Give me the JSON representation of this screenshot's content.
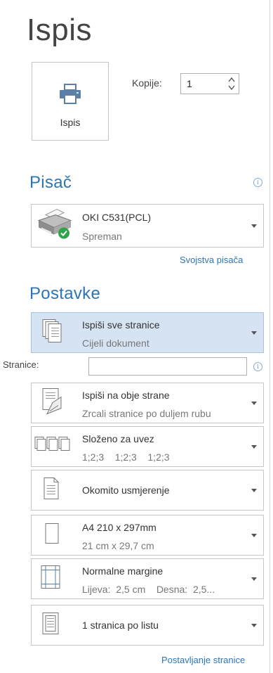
{
  "title": "Ispis",
  "print_button": {
    "label": "Ispis",
    "icon": "printer-icon"
  },
  "copies": {
    "label": "Kopije:",
    "value": "1"
  },
  "printer_section": {
    "title": "Pisač",
    "printer": {
      "name": "OKI C531(PCL)",
      "status": "Spreman",
      "icon": "printer-ready-icon"
    },
    "properties_link": "Svojstva pisača"
  },
  "settings_section": {
    "title": "Postavke",
    "items": [
      {
        "line1": "Ispiši sve stranice",
        "line2": "Cijeli dokument",
        "icon": "pages-icon",
        "selected": true
      },
      {
        "line1": "Ispiši na obje strane",
        "line2": "Zrcali stranice po duljem rubu",
        "icon": "duplex-icon"
      },
      {
        "line1": "Složeno za uvez",
        "line2": "1;2;3    1;2;3    1;2;3",
        "icon": "collated-icon"
      },
      {
        "line1": "Okomito usmjerenje",
        "line2": "",
        "icon": "portrait-icon"
      },
      {
        "line1": "A4 210 x 297mm",
        "line2": "21 cm x 29,7 cm",
        "icon": "paper-size-icon"
      },
      {
        "line1": "Normalne margine",
        "line2": "Lijeva:  2,5 cm    Desna:  2,5...",
        "icon": "margins-icon"
      },
      {
        "line1": "1 stranica po listu",
        "line2": "",
        "icon": "pages-per-sheet-icon"
      }
    ],
    "pages_label": "Stranice:",
    "pages_value": "",
    "page_setup_link": "Postavljanje stranice"
  },
  "colors": {
    "accent": "#2e75b6",
    "selected_bg": "#d5e3f2"
  }
}
